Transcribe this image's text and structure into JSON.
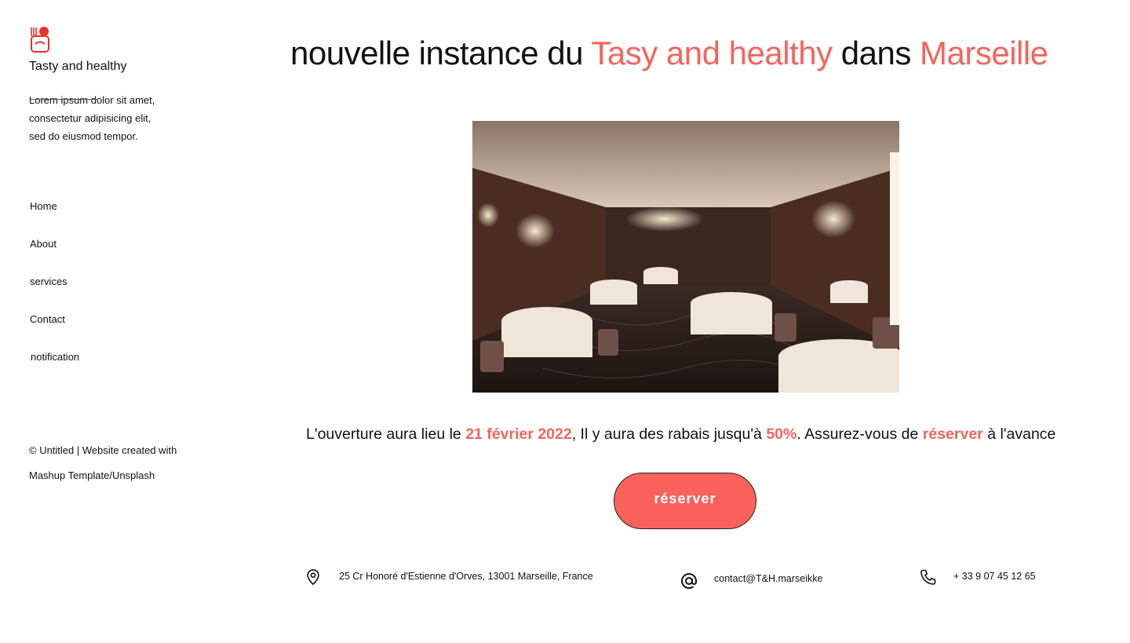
{
  "sidebar": {
    "brand": "Tasty and healthy",
    "tagline": [
      "Lorem ipsum dolor sit amet,",
      "consectetur adipisicing elit,",
      "sed  do eiusmod tempor."
    ],
    "nav": [
      "Home",
      "About",
      "services",
      "Contact",
      "notification"
    ],
    "footer": [
      "© Untitled | Website created with",
      "Mashup Template/Unsplash"
    ]
  },
  "main": {
    "title": {
      "part1": "nouvelle instance du ",
      "accent1": "Tasy and healthy",
      "part2": " dans ",
      "accent2": "Marseille"
    },
    "announce": {
      "t1": "L'ouverture aura lieu le ",
      "date": "21 février 2022",
      "t2": ",  Il y aura des rabais jusqu'à ",
      "discount": "50%",
      "t3": ".  Assurez-vous de ",
      "reserve_word": "réserver",
      "t4": " à l'avance"
    },
    "reserve_button": "réserver"
  },
  "contact": {
    "address": "25 Cr Honoré d'Estienne d'Orves, 13001 Marseille, France",
    "email": "contact@T&H.marseikke",
    "phone": "+ 33 9 07 45 12 65"
  },
  "icons": {
    "logo": "chef-hat-icon",
    "address": "map-pin-icon",
    "email": "at-sign-icon",
    "phone": "phone-icon"
  },
  "colors": {
    "accent": "#f4645e",
    "button": "#fb625c",
    "text": "#111111"
  }
}
